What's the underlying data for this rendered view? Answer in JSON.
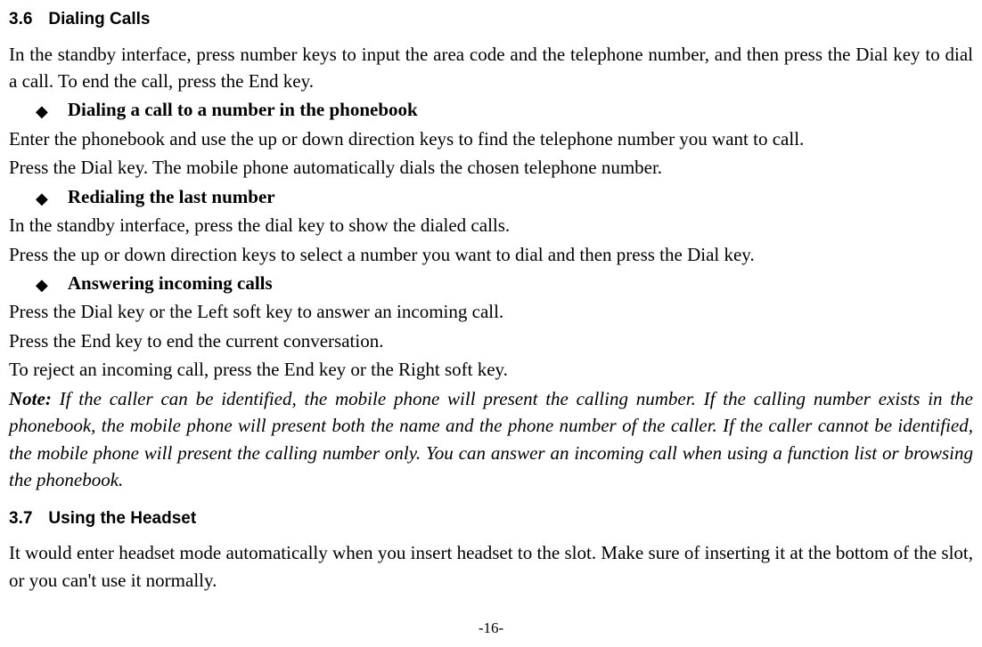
{
  "section36": {
    "num": "3.6",
    "title": "Dialing Calls",
    "intro": "In the standby interface, press number keys to input the area code and the telephone number, and then press the Dial key to dial a call. To end the call, press the End key.",
    "b1_title": "Dialing a call to a number in the phonebook",
    "b1_p1": "Enter the phonebook and use the up or down direction keys to find the telephone number you want to call.",
    "b1_p2": "Press the Dial key. The mobile phone automatically dials the chosen telephone number.",
    "b2_title": "Redialing the last number",
    "b2_p1": "In the standby interface, press the dial key to show the dialed calls.",
    "b2_p2": "Press the up or down direction keys to select a number you want to dial and then press the Dial key.",
    "b3_title": "Answering incoming calls",
    "b3_p1": "Press the Dial key or the Left soft key to answer an incoming call.",
    "b3_p2": "Press the End key to end the current conversation.",
    "b3_p3": "To reject an incoming call, press the End key or the Right soft key.",
    "note_label": "Note:",
    "note_body": " If the caller can be identified, the mobile phone will present the calling number. If the calling number exists in the phonebook, the mobile phone will present both the name and the phone number of the caller. If the caller cannot be identified, the mobile phone will present the calling number only. You can answer an incoming call when using a function list or browsing the phonebook."
  },
  "section37": {
    "num": "3.7",
    "title": "Using the Headset",
    "p1": "It would enter headset mode automatically when you insert headset to the slot. Make sure of inserting it at the bottom of the slot, or you can't use it normally."
  },
  "page_number": "-16-"
}
